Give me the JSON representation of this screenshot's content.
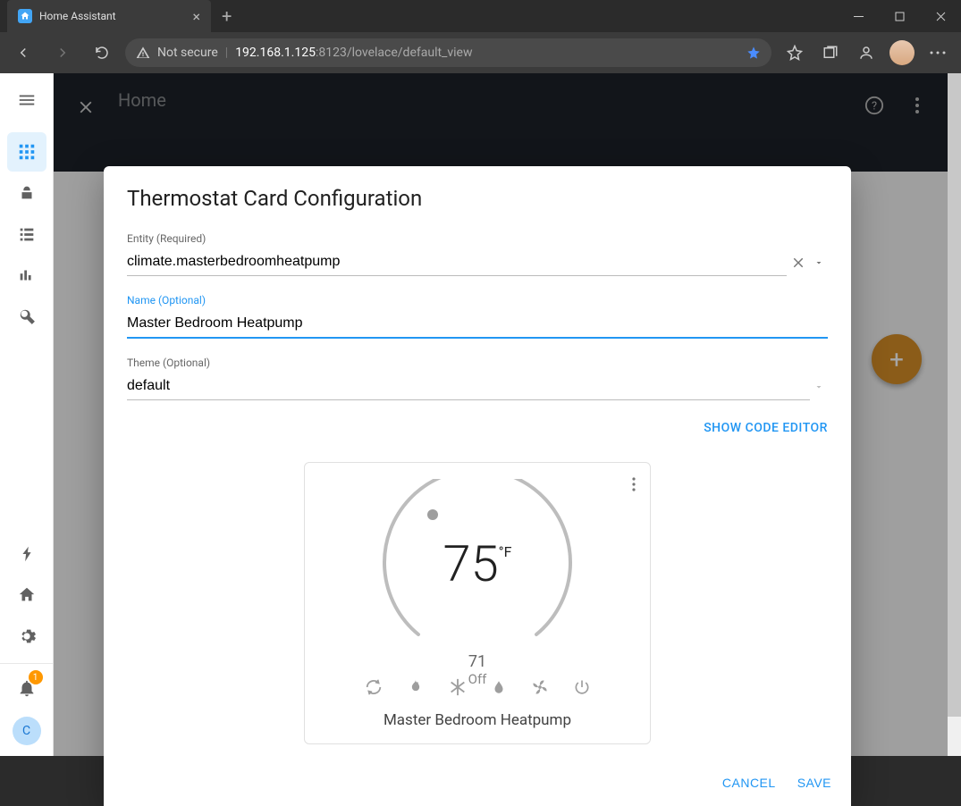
{
  "browser": {
    "tab_title": "Home Assistant",
    "security_label": "Not secure",
    "url_host": "192.168.1.125",
    "url_port_path": ":8123/lovelace/default_view"
  },
  "topbar": {
    "title": "Home"
  },
  "sidebar": {
    "user_initial": "C",
    "notif_count": "1"
  },
  "modal": {
    "title": "Thermostat Card Configuration",
    "entity_label": "Entity (Required)",
    "entity_value": "climate.masterbedroomheatpump",
    "name_label": "Name (Optional)",
    "name_value": "Master Bedroom Heatpump",
    "theme_label": "Theme (Optional)",
    "theme_value": "default",
    "show_code": "SHOW CODE EDITOR",
    "cancel": "CANCEL",
    "save": "SAVE"
  },
  "preview": {
    "set_temp": "75",
    "unit": "°F",
    "current": "71",
    "state": "Off",
    "name": "Master Bedroom Heatpump"
  }
}
